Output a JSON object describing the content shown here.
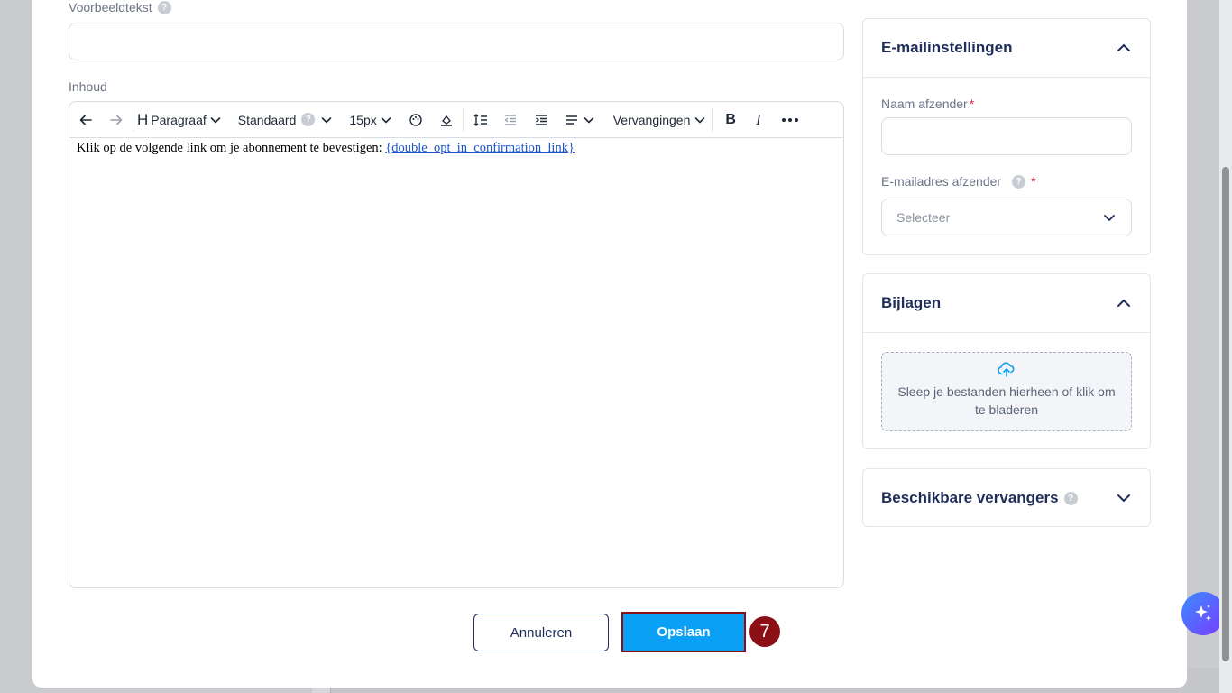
{
  "form": {
    "preview_label": "Voorbeeldtekst",
    "preview_value": "",
    "content_label": "Inhoud"
  },
  "toolbar": {
    "heading_label": "Paragraaf",
    "font_label": "Standaard",
    "size_label": "15px",
    "replacements_label": "Vervangingen"
  },
  "editor": {
    "text": "Klik op de volgende link om je abonnement te bevestigen: ",
    "link": "{double_opt_in_confirmation_link}"
  },
  "email_settings": {
    "title": "E-mailinstellingen",
    "sender_name_label": "Naam afzender",
    "required_mark": "*",
    "sender_email_label": "E-mailadres afzender",
    "sender_email_placeholder": "Selecteer"
  },
  "attachments": {
    "title": "Bijlagen",
    "dropzone_text": "Sleep je bestanden hierheen of klik om te bladeren"
  },
  "replacements_panel": {
    "title": "Beschikbare vervangers"
  },
  "actions": {
    "cancel_label": "Annuleren",
    "save_label": "Opslaan",
    "step_number": "7"
  },
  "colors": {
    "primary": "#0aa0f5",
    "navy": "#1f2d5a",
    "highlight": "#8b0f14",
    "required": "#e0243f"
  }
}
